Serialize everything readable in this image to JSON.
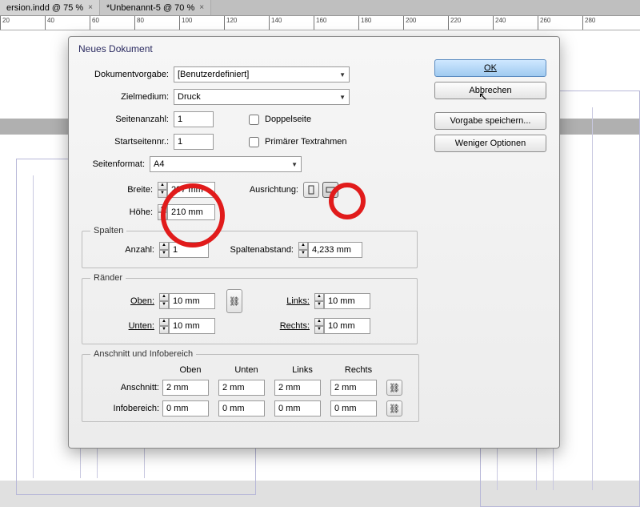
{
  "tabs": [
    {
      "label": "ersion.indd @ 75 %"
    },
    {
      "label": "*Unbenannt-5 @ 70 %"
    }
  ],
  "ruler": {
    "start": 20,
    "step": 20,
    "count": 14
  },
  "dialog": {
    "title": "Neues Dokument",
    "buttons": {
      "ok": "OK",
      "cancel": "Abbrechen",
      "savePreset": "Vorgabe speichern...",
      "lessOptions": "Weniger Optionen"
    },
    "preset": {
      "label": "Dokumentvorgabe:",
      "value": "[Benutzerdefiniert]"
    },
    "intent": {
      "label": "Zielmedium:",
      "value": "Druck"
    },
    "pages": {
      "label": "Seitenanzahl:",
      "value": "1"
    },
    "startPage": {
      "label": "Startseitennr.:",
      "value": "1"
    },
    "facing": {
      "label": "Doppelseite"
    },
    "primaryFrame": {
      "label": "Primärer Textrahmen"
    },
    "pageSize": {
      "label": "Seitenformat:",
      "value": "A4"
    },
    "width": {
      "label": "Breite:",
      "value": "297 mm"
    },
    "height": {
      "label": "Höhe:",
      "value": "210 mm"
    },
    "orientation": {
      "label": "Ausrichtung:"
    },
    "columns": {
      "legend": "Spalten",
      "count": {
        "label": "Anzahl:",
        "value": "1"
      },
      "gutter": {
        "label": "Spaltenabstand:",
        "value": "4,233 mm"
      }
    },
    "margins": {
      "legend": "Ränder",
      "top": {
        "label": "Oben:",
        "value": "10 mm"
      },
      "bottom": {
        "label": "Unten:",
        "value": "10 mm"
      },
      "left": {
        "label": "Links:",
        "value": "10 mm"
      },
      "right": {
        "label": "Rechts:",
        "value": "10 mm"
      }
    },
    "bleedSlug": {
      "legend": "Anschnitt und Infobereich",
      "headers": {
        "top": "Oben",
        "bottom": "Unten",
        "left": "Links",
        "right": "Rechts"
      },
      "bleed": {
        "label": "Anschnitt:",
        "top": "2 mm",
        "bottom": "2 mm",
        "left": "2 mm",
        "right": "2 mm"
      },
      "slug": {
        "label": "Infobereich:",
        "top": "0 mm",
        "bottom": "0 mm",
        "left": "0 mm",
        "right": "0 mm"
      }
    }
  }
}
